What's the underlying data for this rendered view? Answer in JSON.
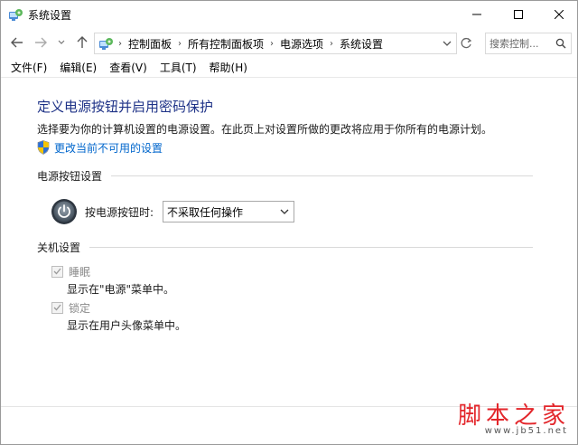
{
  "window": {
    "title": "系统设置"
  },
  "navigation": {
    "breadcrumbs": [
      "控制面板",
      "所有控制面板项",
      "电源选项",
      "系统设置"
    ],
    "search_placeholder": "搜索控制..."
  },
  "menubar": {
    "items": [
      "文件(F)",
      "编辑(E)",
      "查看(V)",
      "工具(T)",
      "帮助(H)"
    ]
  },
  "content": {
    "title": "定义电源按钮并启用密码保护",
    "description": "选择要为你的计算机设置的电源设置。在此页上对设置所做的更改将应用于你所有的电源计划。",
    "change_link": "更改当前不可用的设置",
    "power_section": {
      "heading": "电源按钮设置",
      "label": "按电源按钮时:",
      "selected": "不采取任何操作"
    },
    "shutdown_section": {
      "heading": "关机设置",
      "options": [
        {
          "label": "睡眠",
          "checked": true,
          "description": "显示在\"电源\"菜单中。"
        },
        {
          "label": "锁定",
          "checked": true,
          "description": "显示在用户头像菜单中。"
        }
      ]
    }
  },
  "watermark": {
    "text": "脚本之家",
    "url": "www.jb51.net"
  },
  "colors": {
    "title_blue": "#1e3287",
    "link_blue": "#0066cc",
    "watermark_red": "#e3262b"
  }
}
